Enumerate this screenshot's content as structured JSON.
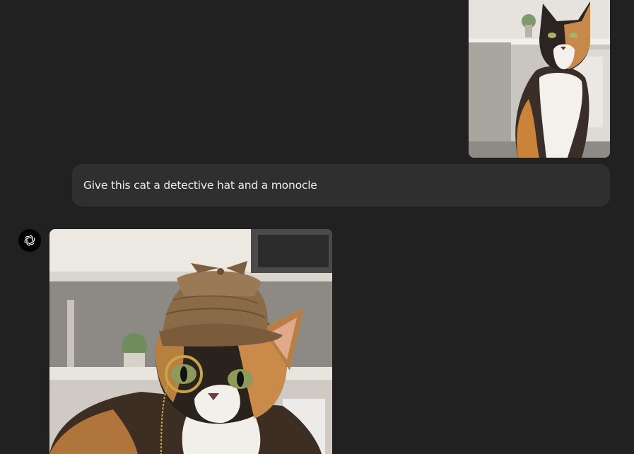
{
  "colors": {
    "background": "#212121",
    "user_bubble": "#2f2f2f",
    "text": "#ececec",
    "avatar_bg": "#000000"
  },
  "conversation": {
    "user_message": {
      "attachment_icon": "uploaded-cat-photo",
      "text": "Give this cat a detective hat and a monocle"
    },
    "assistant_message": {
      "avatar_icon": "openai-logo-icon",
      "attachment_icon": "generated-detective-cat-image"
    }
  }
}
